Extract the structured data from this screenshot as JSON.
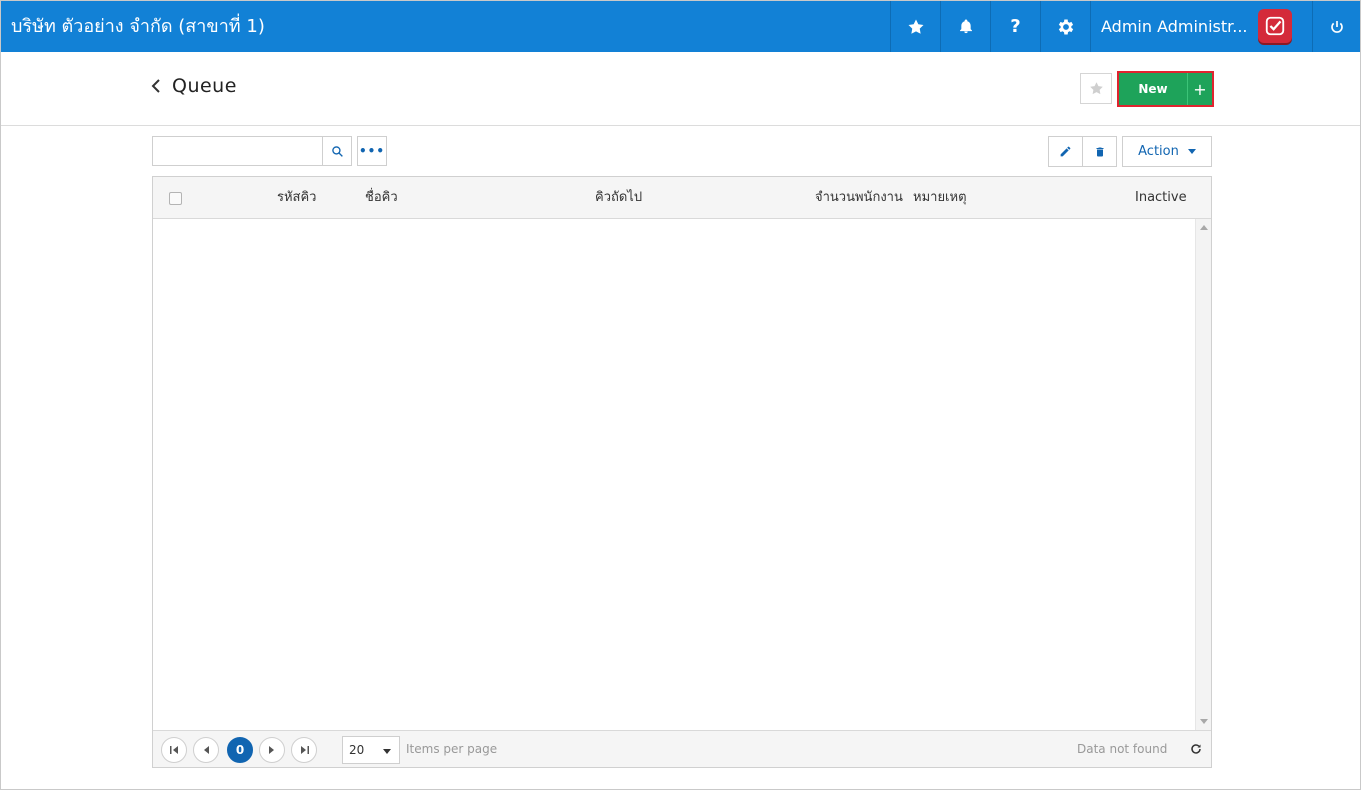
{
  "topbar": {
    "company": "บริษัท ตัวอย่าง จำกัด (สาขาที่ 1)",
    "help_label": "?",
    "user_name": "Admin Administr...",
    "icons": [
      "star-icon",
      "bell-icon",
      "help-icon",
      "gear-icon",
      "power-icon"
    ]
  },
  "header": {
    "title": "Queue",
    "new_label": "New",
    "plus_label": "+"
  },
  "toolbar": {
    "search_value": "",
    "more_label": "•••",
    "action_label": "Action"
  },
  "grid": {
    "columns": [
      "รหัสคิว",
      "ชื่อคิว",
      "คิวถัดไป",
      "จำนวนพนักงาน",
      "หมายเหตุ",
      "Inactive"
    ],
    "rows": []
  },
  "pager": {
    "current_page": "0",
    "page_size": "20",
    "items_per_page_label": "Items per page",
    "status": "Data not found"
  },
  "colors": {
    "topbar": "#1281d6",
    "new_button": "#1ea35a",
    "highlight_border": "#e0242f",
    "accent": "#1165b1"
  }
}
